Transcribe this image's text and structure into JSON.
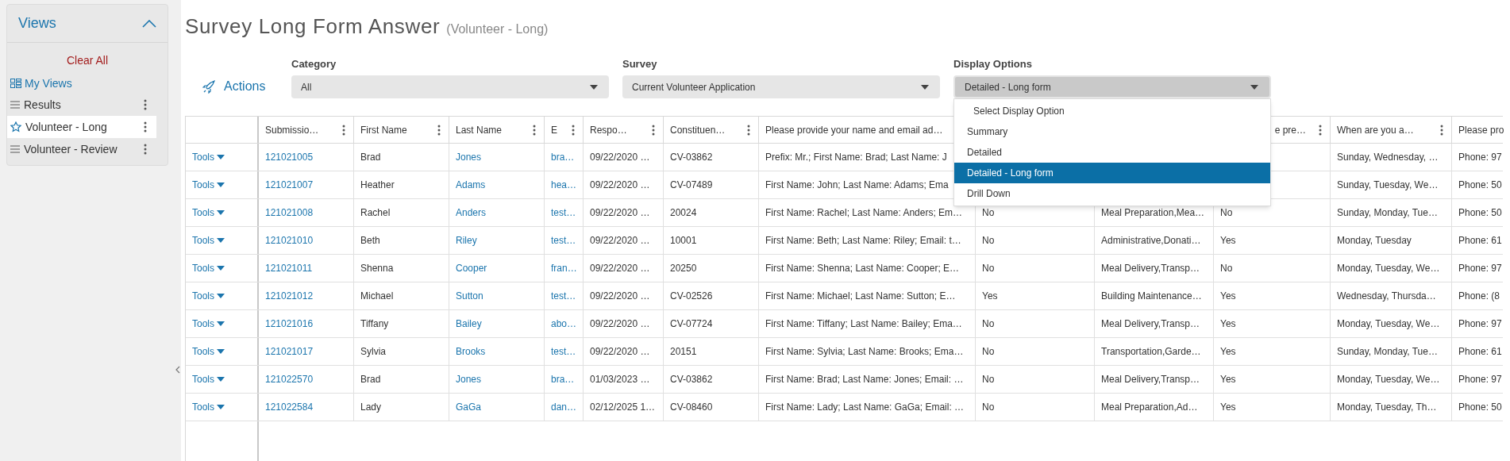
{
  "sidebar": {
    "title": "Views",
    "expanded": true,
    "clear_all": "Clear All",
    "my_views": "My Views",
    "items": [
      {
        "label": "Results",
        "kind": "list",
        "selected": false
      },
      {
        "label": "Volunteer - Long",
        "kind": "star",
        "selected": true
      },
      {
        "label": "Volunteer - Review",
        "kind": "list",
        "selected": false
      }
    ]
  },
  "page": {
    "title": "Survey Long Form Answer",
    "subtitle": "(Volunteer - Long)"
  },
  "toolbar": {
    "actions": "Actions",
    "filters": [
      {
        "label": "Category",
        "value": "All",
        "open": false
      },
      {
        "label": "Survey",
        "value": "Current Volunteer Application",
        "open": false
      },
      {
        "label": "Display Options",
        "value": "Detailed - Long form",
        "open": true,
        "options": [
          {
            "label": "Select Display Option",
            "kind": "placeholder",
            "selected": false
          },
          {
            "label": "Summary",
            "kind": "option",
            "selected": false
          },
          {
            "label": "Detailed",
            "kind": "option",
            "selected": false
          },
          {
            "label": "Detailed - Long form",
            "kind": "option",
            "selected": true
          },
          {
            "label": "Drill Down",
            "kind": "option",
            "selected": false
          }
        ]
      }
    ]
  },
  "table": {
    "columns": [
      {
        "label": "Submissio…",
        "kind": "link",
        "menu": true
      },
      {
        "label": "First Name",
        "kind": "text",
        "menu": true
      },
      {
        "label": "Last Name",
        "kind": "link",
        "menu": true
      },
      {
        "label": "E",
        "kind": "link",
        "menu": true
      },
      {
        "label": "Respo…",
        "kind": "text",
        "menu": true
      },
      {
        "label": "Constituen…",
        "kind": "text",
        "menu": true
      },
      {
        "label": "Please provide your name and email ad…",
        "kind": "text",
        "menu": false
      },
      {
        "kind": "text"
      },
      {
        "kind": "text"
      },
      {
        "label": "e pre…",
        "kind": "text",
        "menu": true
      },
      {
        "label": "When are you a…",
        "kind": "text",
        "menu": true
      },
      {
        "label": "Please pro",
        "kind": "text"
      }
    ],
    "rows": [
      {
        "tools": "Tools",
        "cells": [
          "121021005",
          "Brad",
          "Jones",
          "bra…",
          "09/22/2020 …",
          "CV-03862",
          "Prefix: Mr.; First Name: Brad; Last Name: J",
          null,
          null,
          null,
          "Sunday, Wednesday, …",
          "Phone: 97"
        ]
      },
      {
        "tools": "Tools",
        "cells": [
          "121021007",
          "Heather",
          "Adams",
          "hea…",
          "09/22/2020 …",
          "CV-07489",
          "First Name: John; Last Name: Adams; Ema",
          null,
          null,
          null,
          "Sunday, Tuesday, We…",
          "Phone: 50"
        ]
      },
      {
        "tools": "Tools",
        "cells": [
          "121021008",
          "Rachel",
          "Anders",
          "test…",
          "09/22/2020 …",
          "20024",
          "First Name: Rachel; Last Name: Anders; Em…",
          "No",
          "Meal Preparation,Mea…",
          "No",
          "Sunday, Monday, Tue…",
          "Phone: 50"
        ]
      },
      {
        "tools": "Tools",
        "cells": [
          "121021010",
          "Beth",
          "Riley",
          "test…",
          "09/22/2020 …",
          "10001",
          "First Name: Beth; Last Name: Riley; Email: t…",
          "No",
          "Administrative,Donati…",
          "Yes",
          "Monday, Tuesday",
          "Phone: 61"
        ]
      },
      {
        "tools": "Tools",
        "cells": [
          "121021011",
          "Shenna",
          "Cooper",
          "fran…",
          "09/22/2020 …",
          "20250",
          "First Name: Shenna; Last Name: Cooper; E…",
          "No",
          "Meal Delivery,Transp…",
          "No",
          "Monday, Tuesday, We…",
          "Phone: 97"
        ]
      },
      {
        "tools": "Tools",
        "cells": [
          "121021012",
          "Michael",
          "Sutton",
          "test…",
          "09/22/2020 …",
          "CV-02526",
          "First Name: Michael; Last Name: Sutton; E…",
          "Yes",
          "Building Maintenance…",
          "Yes",
          "Wednesday, Thursda…",
          "Phone: (8"
        ]
      },
      {
        "tools": "Tools",
        "cells": [
          "121021016",
          "Tiffany",
          "Bailey",
          "abo…",
          "09/22/2020 …",
          "CV-07724",
          "First Name: Tiffany; Last Name: Bailey; Ema…",
          "No",
          "Meal Delivery,Transp…",
          "Yes",
          "Monday, Tuesday, We…",
          "Phone: 97"
        ]
      },
      {
        "tools": "Tools",
        "cells": [
          "121021017",
          "Sylvia",
          "Brooks",
          "test…",
          "09/22/2020 …",
          "20151",
          "First Name: Sylvia; Last Name: Brooks; Ema…",
          "No",
          "Transportation,Garde…",
          "Yes",
          "Sunday, Monday, Tue…",
          "Phone: 61"
        ]
      },
      {
        "tools": "Tools",
        "cells": [
          "121022570",
          "Brad",
          "Jones",
          "bra…",
          "01/03/2023 …",
          "CV-03862",
          "First Name: Brad; Last Name: Jones; Email: …",
          "No",
          "Meal Delivery,Transp…",
          "Yes",
          "Monday, Tuesday, We…",
          "Phone: 97"
        ]
      },
      {
        "tools": "Tools",
        "cells": [
          "121022584",
          "Lady",
          "GaGa",
          "dan…",
          "02/12/2025 1…",
          "CV-08460",
          "First Name: Lady; Last Name: GaGa; Email: …",
          "No",
          "Meal Preparation,Ad…",
          "Yes",
          "Monday, Tuesday, Th…",
          "Phone: 50"
        ]
      }
    ]
  }
}
